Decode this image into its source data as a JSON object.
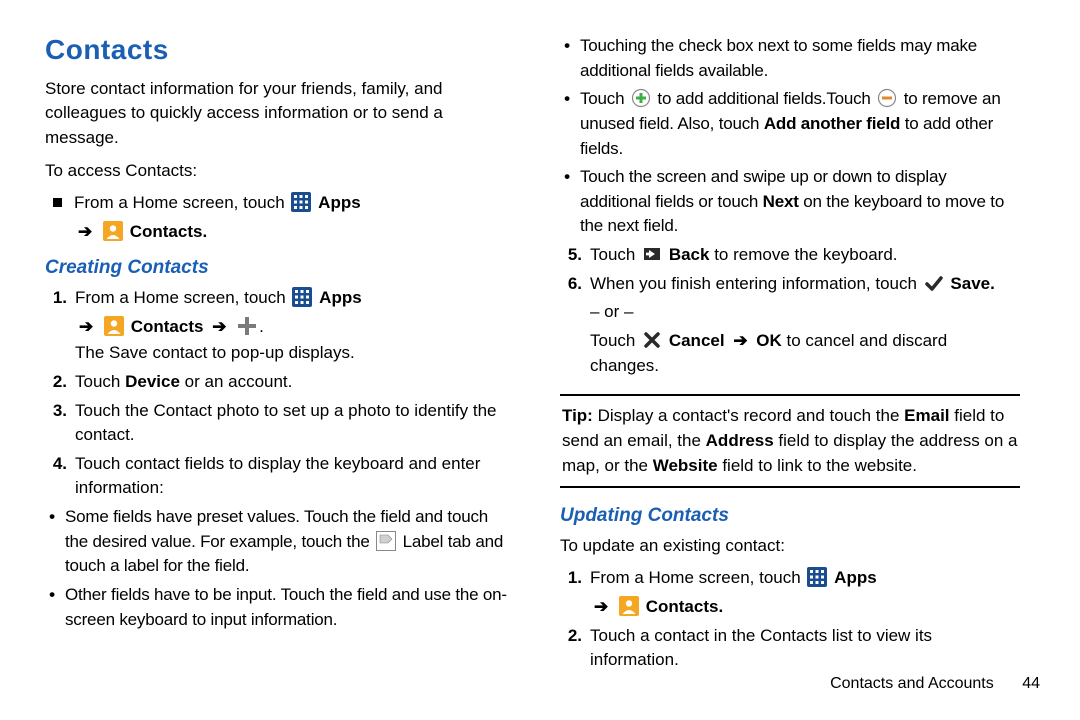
{
  "title": "Contacts",
  "intro": "Store contact information for your friends, family, and colleagues to quickly access information or to send a message.",
  "accessLabel": "To access Contacts:",
  "fromHome": "From a Home screen, touch",
  "apps": "Apps",
  "contacts": "Contacts",
  "creating": {
    "heading": "Creating Contacts",
    "step1": "From a Home screen, touch",
    "step1b": "The Save contact to pop-up displays.",
    "step2a": "Touch ",
    "step2b": "Device",
    "step2c": " or an account.",
    "step3": "Touch the Contact photo to set up a photo to identify the contact.",
    "step4": "Touch contact fields to display the keyboard and enter information:",
    "b1a": "Some fields have preset values. Touch the field and touch the desired value. For example, touch the ",
    "b1b": " Label tab and touch a label for the field.",
    "b2": "Other fields have to be input. Touch the field and use the on-screen keyboard to input information."
  },
  "right": {
    "b3": "Touching the check box next to some fields may make additional fields available.",
    "b4a": "Touch ",
    "b4b": " to add additional fields.Touch ",
    "b4c": " to remove an unused field. Also, touch ",
    "b4d": "Add another field",
    "b4e": " to add other fields.",
    "b5a": "Touch the screen and swipe up or down to display additional fields or touch ",
    "b5b": "Next",
    "b5c": " on the keyboard to move to the next field.",
    "step5a": "Touch ",
    "step5b": "Back",
    "step5c": " to remove the keyboard.",
    "step6a": "When you finish entering information, touch ",
    "step6b": "Save",
    "step6or": "– or –",
    "step6c": "Touch ",
    "step6d": "Cancel",
    "step6e": "OK",
    "step6f": " to cancel and discard changes."
  },
  "tip": {
    "label": "Tip:",
    "a": " Display a contact's record and touch the ",
    "email": "Email",
    "b": " field to send an email, the ",
    "address": "Address",
    "c": " field to display the address on a map, or the ",
    "website": "Website",
    "d": " field to link to the website."
  },
  "updating": {
    "heading": "Updating Contacts",
    "intro": "To update an existing contact:",
    "step1": "From a Home screen, touch",
    "step2": "Touch a contact in the Contacts list to view its information."
  },
  "footer": {
    "section": "Contacts and Accounts",
    "page": "44"
  }
}
